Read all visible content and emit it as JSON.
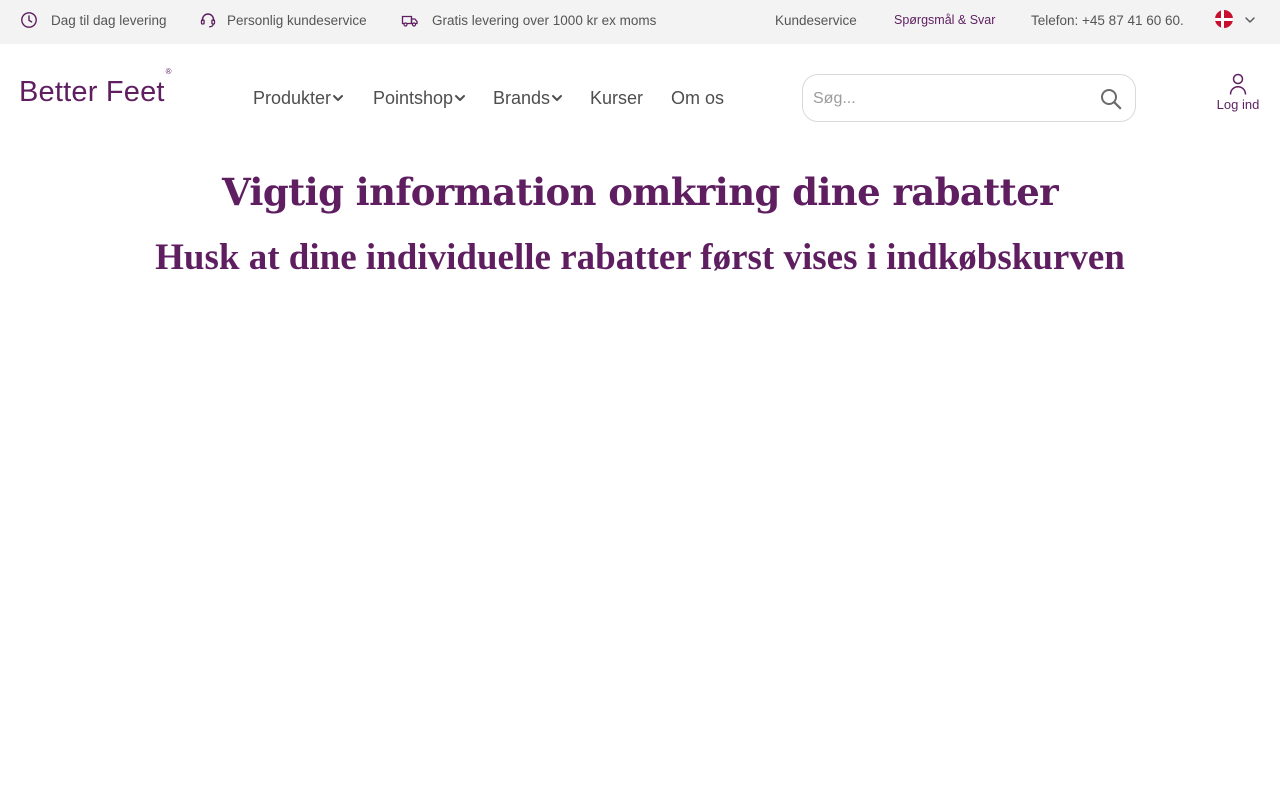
{
  "topbar": {
    "usps": [
      {
        "icon": "clock-icon",
        "label": "Dag til dag levering"
      },
      {
        "icon": "headset-icon",
        "label": "Personlig kundeservice"
      },
      {
        "icon": "delivery-truck-icon",
        "label": "Gratis levering over 1000 kr ex moms"
      }
    ],
    "links": {
      "customer_service": "Kundeservice",
      "faq": "Spørgsmål & Svar",
      "phone": "Telefon: +45 87 41 60 60."
    },
    "language": {
      "icon": "denmark-flag-icon",
      "selected": "Dansk"
    }
  },
  "header": {
    "logo": "Better Feet",
    "logo_mark": "®",
    "nav": [
      {
        "label": "Produkter",
        "dropdown": true
      },
      {
        "label": "Pointshop",
        "dropdown": true
      },
      {
        "label": "Brands",
        "dropdown": true
      },
      {
        "label": "Kurser",
        "dropdown": false
      },
      {
        "label": "Om os",
        "dropdown": false
      }
    ],
    "search": {
      "placeholder": "Søg...",
      "value": ""
    },
    "login_label": "Log ind"
  },
  "main": {
    "headline": "Vigtig information omkring dine rabatter",
    "subline": "Husk at dine individuelle rabatter først vises i indkøbskurven"
  },
  "colors": {
    "brand": "#5e1e60",
    "topbar_bg": "#f3f3f3",
    "text": "#4e4e4e",
    "flag_red": "#c8102e"
  }
}
